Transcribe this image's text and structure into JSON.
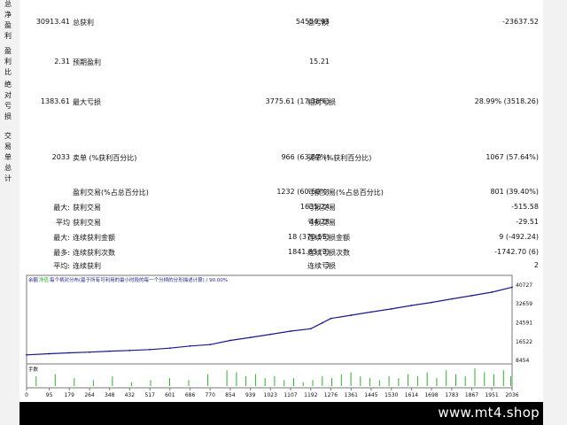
{
  "labels": {
    "net_profit": "总净盈利",
    "gross_profit": "总获利",
    "gross_loss": "总亏损",
    "profit_factor": "盈利比",
    "expected_payoff": "预期盈利",
    "abs_drawdown": "绝对亏损",
    "max_drawdown": "最大亏损",
    "rel_drawdown": "相对亏损",
    "total_trades": "交易单总计",
    "short_positions": "卖单 (%获利百分比)",
    "long_positions": "买单 (%获利百分比)",
    "profit_trades": "盈利交易(%占总百分比)",
    "loss_trades": "亏损交易(%占总百分比)",
    "largest": "最大:",
    "largest_profit": "获利交易",
    "largest_loss": "亏损交易",
    "average": "平均",
    "average_profit": "获利交易",
    "average_loss": "亏损交易",
    "maximum": "最大:",
    "max_consec_wins": "连续获利金额",
    "max_consec_losses": "连续亏损金额",
    "maximal": "最多:",
    "maximal_consec_profit": "连续获利次数",
    "maximal_consec_loss": "连续亏损次数",
    "average2": "平均:",
    "avg_consec_wins": "连续获利",
    "avg_consec_losses": "连续亏损"
  },
  "values": {
    "net_profit": "30913.41",
    "gross_profit": "54550.93",
    "gross_loss": "-23637.52",
    "profit_factor": "2.31",
    "expected_payoff": "15.21",
    "abs_drawdown": "1383.61",
    "max_drawdown": "3775.61 (17.38%)",
    "rel_drawdown": "28.99% (3518.26)",
    "total_trades": "2033",
    "short_positions": "966 (63.87%)",
    "long_positions": "1067 (57.64%)",
    "profit_trades": "1232 (60.60%)",
    "loss_trades": "801 (39.40%)",
    "largest_profit": "1635.24",
    "largest_loss": "-515.58",
    "average_profit": "44.28",
    "average_loss": "-29.51",
    "max_consec_wins": "18 (370.55)",
    "max_consec_losses": "9 (-492.24)",
    "maximal_consec_profit": "1841.65 (3)",
    "maximal_consec_loss": "-1742.70 (6)",
    "avg_consec_wins": "3",
    "avg_consec_losses": "2"
  },
  "graph": {
    "legend_balance": "余额",
    "legend_equity": "净值",
    "legend_text": "每个柄对分布(基于所有可利用的最小时段的每一个分柄的分形描述计算) / 90.00%",
    "volume_label": "手数",
    "line_color": "#1a1a8c",
    "volume_color": "#2bb52b"
  },
  "chart_data": {
    "type": "line",
    "title": "",
    "xlabel": "",
    "ylabel": "",
    "x_ticks": [
      "0",
      "95",
      "179",
      "264",
      "348",
      "432",
      "517",
      "601",
      "686",
      "770",
      "854",
      "939",
      "1023",
      "1107",
      "1192",
      "1276",
      "1361",
      "1445",
      "1530",
      "1614",
      "1698",
      "1783",
      "1867",
      "1951",
      "2036"
    ],
    "y_ticks": [
      "40727",
      "32659",
      "24591",
      "16522",
      "8454"
    ],
    "ylim": [
      8454,
      40727
    ],
    "xlim": [
      0,
      2036
    ],
    "series": [
      {
        "x": [
          0,
          95,
          179,
          264,
          348,
          432,
          517,
          601,
          686,
          770,
          854,
          939,
          1023,
          1107,
          1192,
          1240,
          1276,
          1361,
          1445,
          1530,
          1614,
          1698,
          1783,
          1867,
          1951,
          2036
        ],
        "values": [
          10800,
          11300,
          11700,
          12000,
          12400,
          12700,
          13100,
          13700,
          14600,
          15200,
          17000,
          18300,
          19600,
          21000,
          22000,
          24500,
          26400,
          27800,
          29200,
          30500,
          32000,
          33300,
          34800,
          36200,
          37700,
          39800
        ]
      }
    ],
    "volume": {
      "x": [
        40,
        120,
        200,
        280,
        360,
        440,
        520,
        600,
        680,
        760,
        840,
        880,
        920,
        960,
        1000,
        1040,
        1080,
        1120,
        1160,
        1200,
        1240,
        1280,
        1320,
        1360,
        1400,
        1440,
        1480,
        1520,
        1560,
        1600,
        1640,
        1680,
        1720,
        1760,
        1800,
        1840,
        1880,
        1920,
        1960,
        2000,
        2030
      ],
      "values": [
        0.5,
        0.6,
        0.4,
        0.3,
        0.5,
        0.2,
        0.3,
        0.4,
        0.3,
        0.6,
        0.8,
        0.7,
        0.5,
        0.6,
        0.4,
        0.5,
        0.3,
        0.4,
        0.2,
        0.3,
        0.5,
        0.4,
        0.6,
        0.7,
        0.5,
        0.4,
        0.3,
        0.5,
        0.4,
        0.6,
        0.5,
        0.7,
        0.4,
        0.8,
        0.6,
        0.5,
        0.9,
        0.7,
        0.6,
        0.8,
        0.5
      ]
    }
  },
  "footer": {
    "watermark": "www.mt4.shop"
  }
}
